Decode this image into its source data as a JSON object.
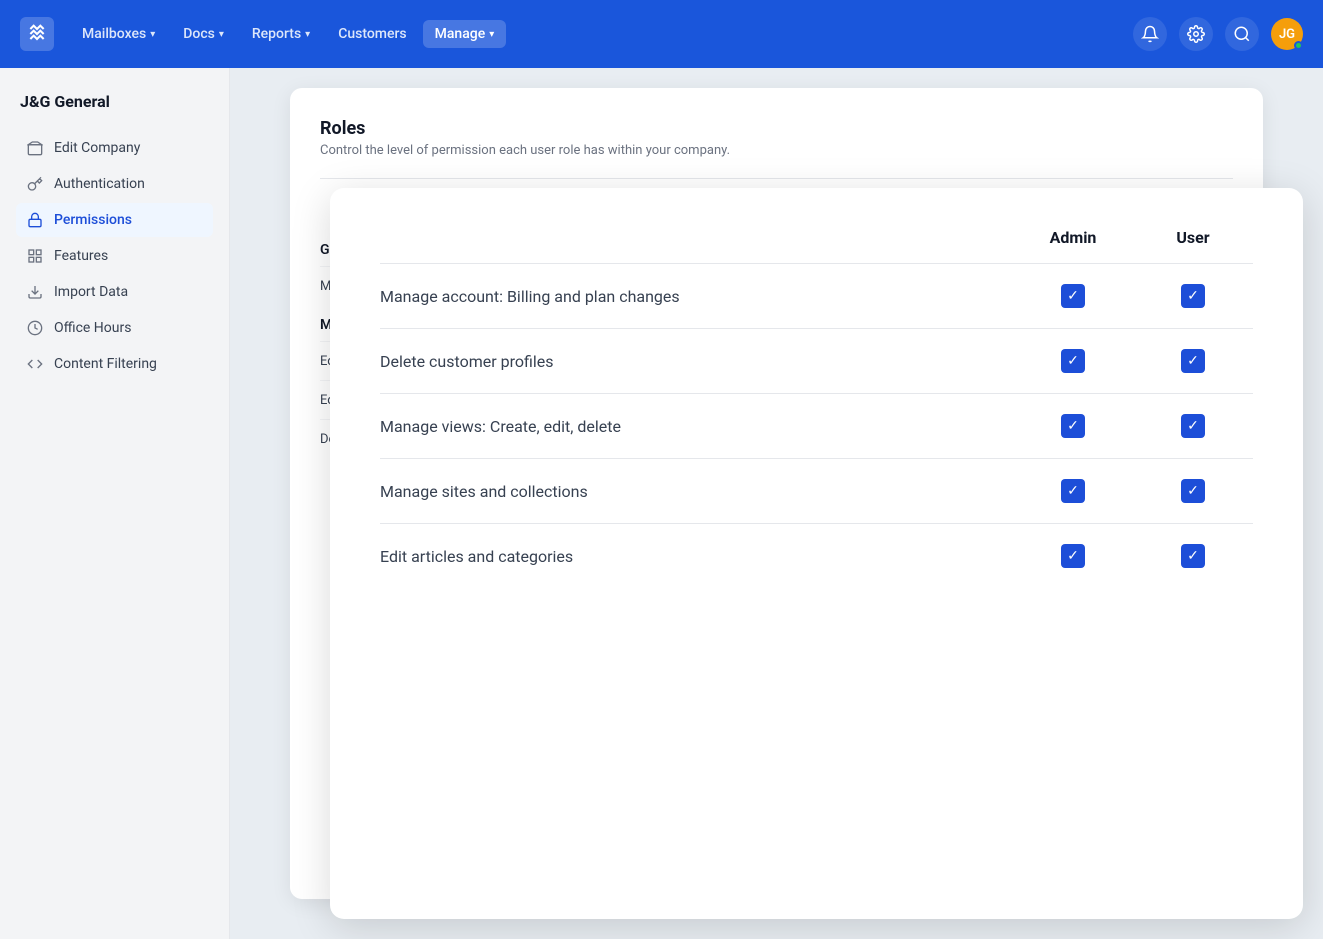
{
  "nav": {
    "logo_label": "logo",
    "items": [
      {
        "label": "Mailboxes",
        "has_chevron": true,
        "active": false
      },
      {
        "label": "Docs",
        "has_chevron": true,
        "active": false
      },
      {
        "label": "Reports",
        "has_chevron": true,
        "active": false
      },
      {
        "label": "Customers",
        "has_chevron": false,
        "active": false
      },
      {
        "label": "Manage",
        "has_chevron": true,
        "active": true
      }
    ]
  },
  "sidebar": {
    "company_name": "J&G General",
    "items": [
      {
        "label": "Edit Company",
        "icon": "building"
      },
      {
        "label": "Authentication",
        "icon": "key"
      },
      {
        "label": "Permissions",
        "icon": "lock",
        "active": true
      },
      {
        "label": "Features",
        "icon": "grid"
      },
      {
        "label": "Import Data",
        "icon": "download"
      },
      {
        "label": "Office Hours",
        "icon": "clock"
      },
      {
        "label": "Content Filtering",
        "icon": "code"
      }
    ]
  },
  "bg_card": {
    "title": "Roles",
    "subtitle": "Control the level of permission each user role has within your company.",
    "header": {
      "admin": "Admin",
      "user": "User"
    },
    "sections": [
      {
        "title": "General",
        "rows": [
          {
            "label": "Manage account: Billing and plan changes",
            "admin": true,
            "user": true
          }
        ]
      },
      {
        "title": "Mailbox",
        "rows": [
          {
            "label": "Edit threads",
            "admin": true,
            "user": true
          },
          {
            "label": "Edit notes",
            "admin": true,
            "user": true
          },
          {
            "label": "Delete conversations",
            "admin": true,
            "user": true
          }
        ]
      }
    ]
  },
  "fg_card": {
    "header": {
      "admin": "Admin",
      "user": "User"
    },
    "rows": [
      {
        "label": "Manage account: Billing and plan changes",
        "admin": true,
        "user": true
      },
      {
        "label": "Delete customer profiles",
        "admin": true,
        "user": true
      },
      {
        "label": "Manage views: Create, edit, delete",
        "admin": true,
        "user": true
      },
      {
        "label": "Manage sites and collections",
        "admin": true,
        "user": true
      },
      {
        "label": "Edit articles and categories",
        "admin": true,
        "user": true
      }
    ]
  }
}
